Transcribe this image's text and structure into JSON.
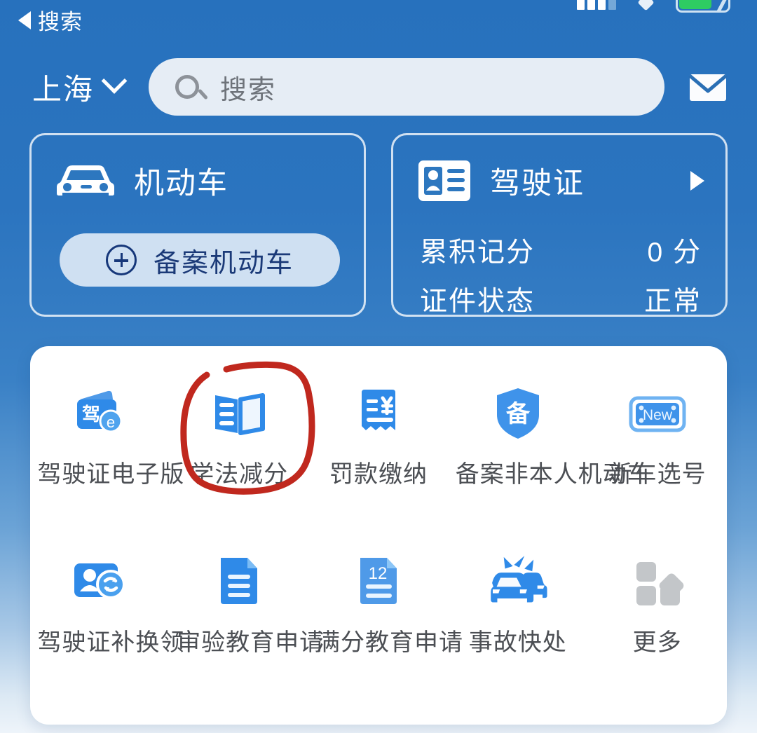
{
  "statusbar": {
    "signal_icon": "signal-bars-icon",
    "wifi_icon": "wifi-diamond-icon",
    "battery_icon": "battery-charging-icon"
  },
  "nav": {
    "back_icon": "back-triangle-icon",
    "back_label": "搜索"
  },
  "search": {
    "city": "上海",
    "city_chevron_icon": "chevron-down-icon",
    "search_icon": "search-icon",
    "placeholder": "搜索",
    "mail_icon": "mail-icon"
  },
  "cards": {
    "vehicle": {
      "icon": "car-icon",
      "title": "机动车",
      "action_icon": "plus-circle-icon",
      "action_label": "备案机动车"
    },
    "license": {
      "icon": "id-card-icon",
      "title": "驾驶证",
      "arrow_icon": "arrow-right-icon",
      "rows": [
        {
          "key": "累积记分",
          "value": "0 分"
        },
        {
          "key": "证件状态",
          "value": "正常"
        }
      ]
    }
  },
  "grid": {
    "items": [
      {
        "icon": "driver-license-ecard-icon",
        "label": "驾驶证电子版"
      },
      {
        "icon": "open-book-icon",
        "label": "学法减分",
        "annotated": true
      },
      {
        "icon": "receipt-yuan-icon",
        "label": "罚款缴纳"
      },
      {
        "icon": "shield-bei-icon",
        "label": "备案非本人机动车"
      },
      {
        "icon": "license-plate-new-icon",
        "label": "新车选号"
      },
      {
        "icon": "person-card-refresh-icon",
        "label": "驾驶证补换领"
      },
      {
        "icon": "document-lines-icon",
        "label": "审验教育申请"
      },
      {
        "icon": "document-12-icon",
        "label": "满分教育申请"
      },
      {
        "icon": "car-crash-icon",
        "label": "事故快处"
      },
      {
        "icon": "more-grid-icon",
        "label": "更多"
      }
    ]
  },
  "annotation": {
    "type": "hand-drawn-circle",
    "color": "#C0281E",
    "target_label": "学法减分"
  },
  "colors": {
    "background_top": "#2771BD",
    "background_bottom": "#EEF4FA",
    "panel": "#FFFFFF",
    "icon_blue": "#2F8AE8",
    "icon_blue_light": "#58A8F0",
    "pill": "#CFE0F2",
    "pill_text": "#1B3A78",
    "label_text": "#4C4F54",
    "annotation_red": "#C0281E"
  }
}
